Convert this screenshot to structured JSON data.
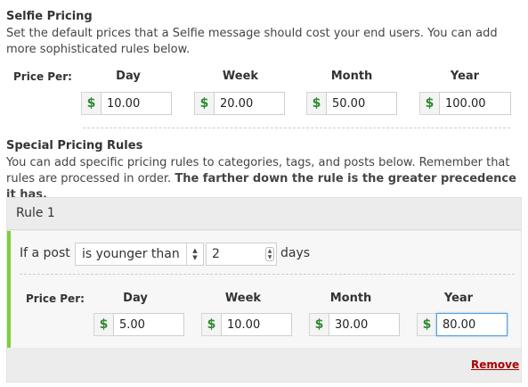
{
  "selfie_pricing": {
    "title": "Selfie Pricing",
    "description": "Set the default prices that a Selfie message should cost your end users. You can add more sophisticated rules below.",
    "row_label": "Price Per:",
    "columns": [
      {
        "label": "Day",
        "currency": "$",
        "value": "10.00"
      },
      {
        "label": "Week",
        "currency": "$",
        "value": "20.00"
      },
      {
        "label": "Month",
        "currency": "$",
        "value": "50.00"
      },
      {
        "label": "Year",
        "currency": "$",
        "value": "100.00"
      }
    ]
  },
  "special_rules": {
    "title": "Special Pricing Rules",
    "description_plain": "You can add specific pricing rules to categories, tags, and posts below. Remember that rules are processed in order.",
    "description_bold": "The farther down the rule is the greater precedence it has."
  },
  "rule": {
    "title": "Rule 1",
    "condition_prefix": "If a post",
    "condition_select": "is younger than",
    "condition_value": "2",
    "condition_unit": "days",
    "row_label": "Price Per:",
    "columns": [
      {
        "label": "Day",
        "currency": "$",
        "value": "5.00"
      },
      {
        "label": "Week",
        "currency": "$",
        "value": "10.00"
      },
      {
        "label": "Month",
        "currency": "$",
        "value": "30.00"
      },
      {
        "label": "Year",
        "currency": "$",
        "value": "80.00"
      }
    ],
    "remove_label": "Remove",
    "accent_color": "#7ad03a"
  }
}
